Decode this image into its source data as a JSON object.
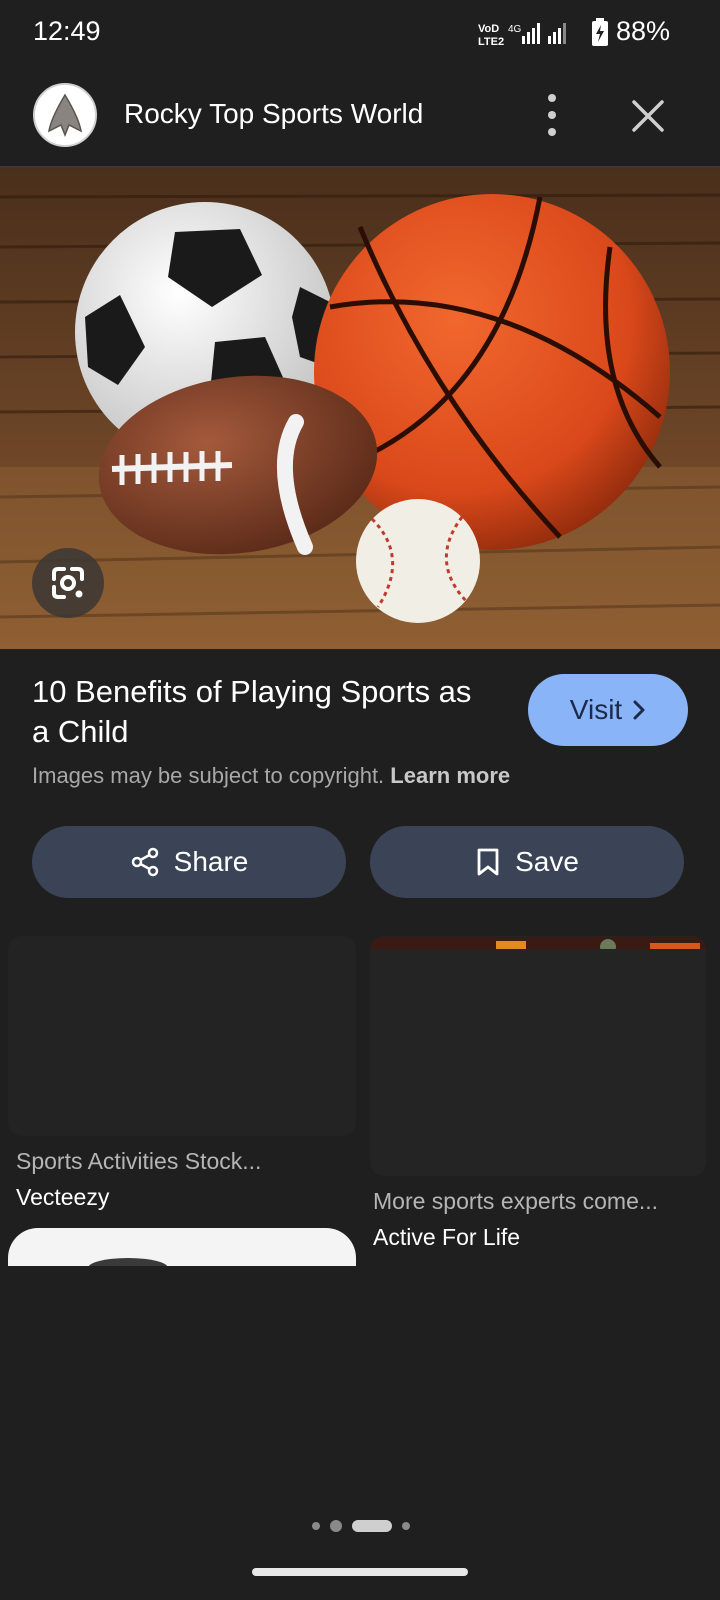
{
  "status_bar": {
    "time": "12:49",
    "network_label": "VoLTE 4G",
    "battery_percent": "88%"
  },
  "header": {
    "site_name": "Rocky Top Sports World",
    "avatar_icon": "arrowhead-logo-icon",
    "more_icon": "more-vert-icon",
    "close_icon": "close-icon"
  },
  "hero": {
    "image_description_icon": "sports-balls-photo",
    "lens_icon": "google-lens-icon"
  },
  "result": {
    "title": "10 Benefits of Playing Sports as a Child",
    "visit_label": "Visit",
    "copyright_text": "Images may be subject to copyright.",
    "learn_more": "Learn more"
  },
  "actions": {
    "share_label": "Share",
    "save_label": "Save"
  },
  "related": [
    {
      "title": "Sports Activities Stock...",
      "source": "Vecteezy"
    },
    {
      "title": "More sports experts come...",
      "source": "Active For Life"
    }
  ],
  "colors": {
    "background": "#1f1f1f",
    "accent": "#8ab4f8",
    "pill": "#3a4456"
  }
}
